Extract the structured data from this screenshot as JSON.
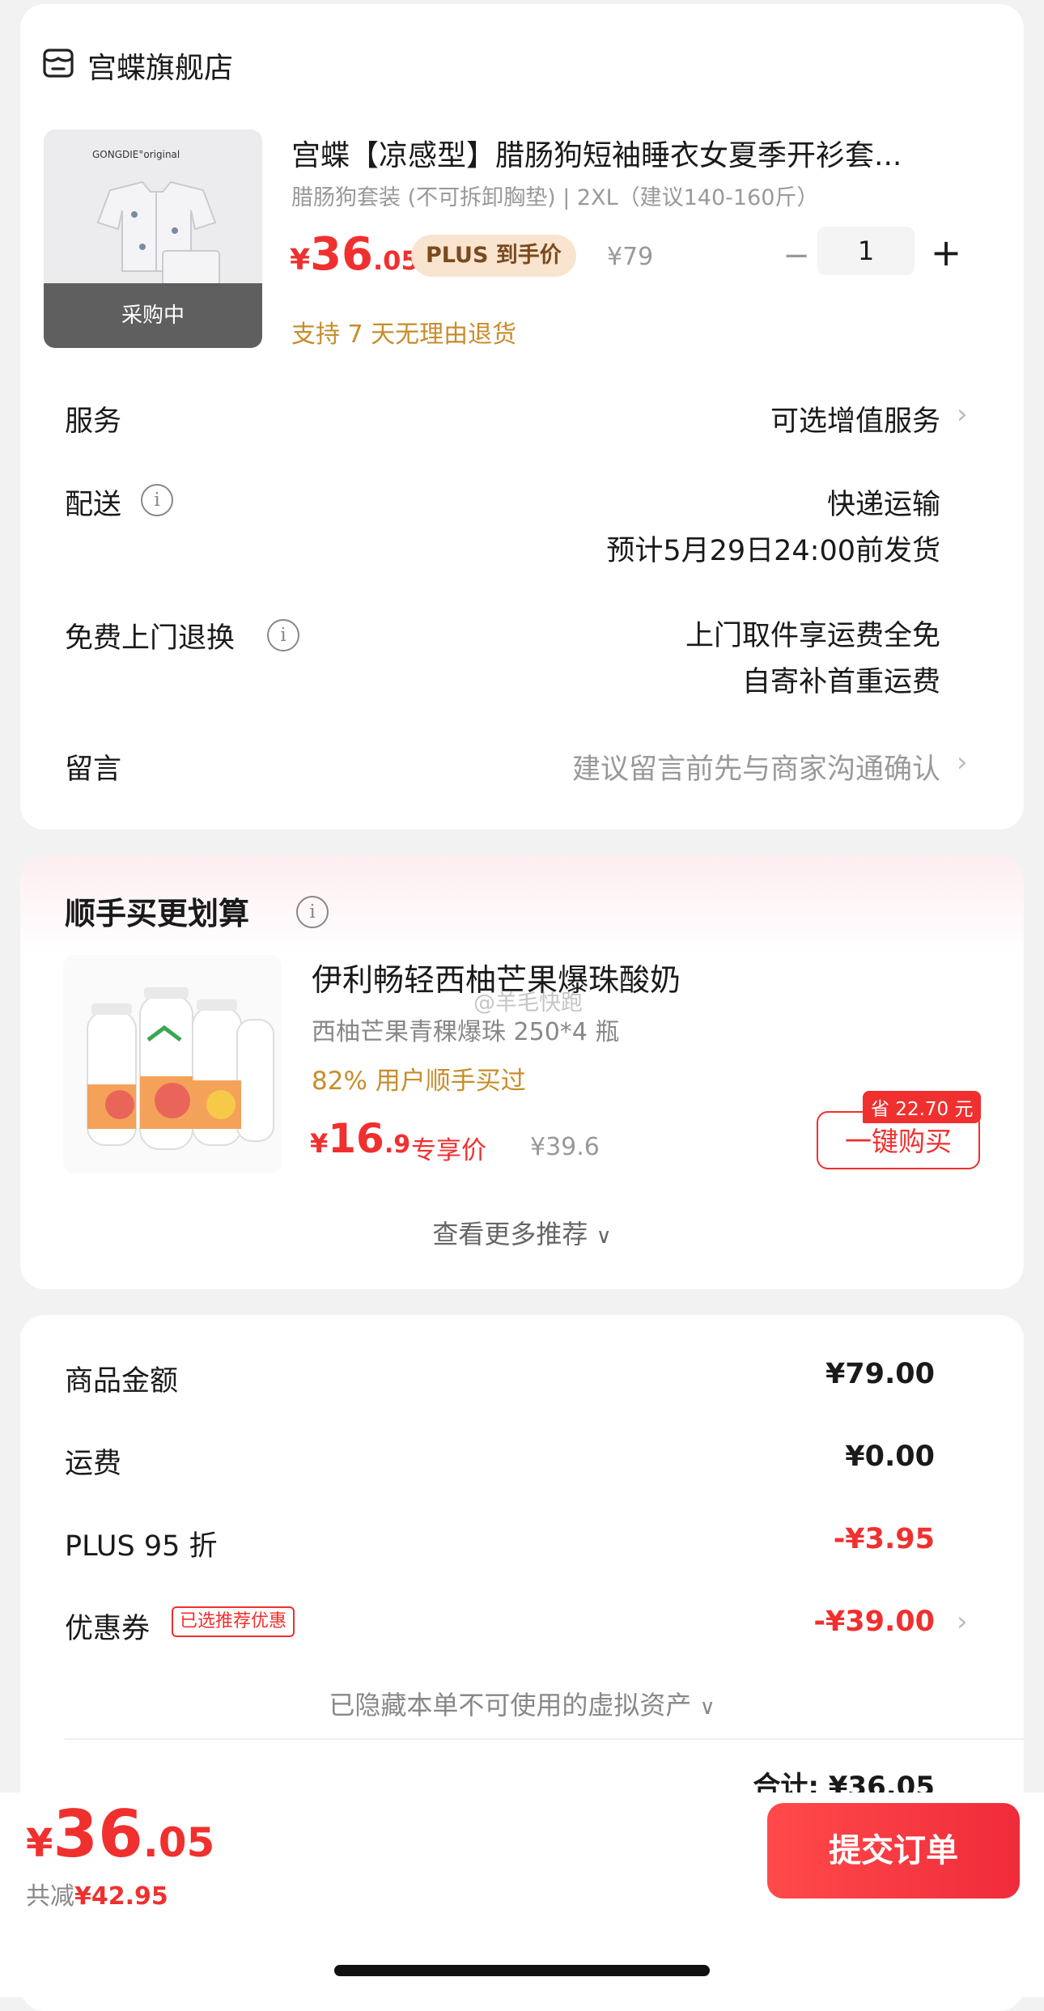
{
  "store": {
    "name": "宫蝶旗舰店",
    "icon": "store-icon"
  },
  "product": {
    "image_brand": "GONGDIE°original",
    "image_overlay": "采购中",
    "title": "宫蝶【凉感型】腊肠狗短袖睡衣女夏季开衫套...",
    "spec": "腊肠狗套装 (不可拆卸胸垫)  |  2XL（建议140-160斤）",
    "price_symbol": "¥",
    "price_int": "36",
    "price_dec": ".05",
    "plus_label": "PLUS 到手价",
    "original_price": "¥79",
    "quantity": "1",
    "return_note": "支持 7 天无理由退货"
  },
  "rows": {
    "service": {
      "label": "服务",
      "value": "可选增值服务"
    },
    "delivery": {
      "label": "配送",
      "line1": "快递运输",
      "line2": "预计5月29日24:00前发货"
    },
    "pickup": {
      "label": "免费上门退换",
      "line1": "上门取件享运费全免",
      "line2": "自寄补首重运费"
    },
    "note": {
      "label": "留言",
      "placeholder": "建议留言前先与商家沟通确认"
    }
  },
  "recommend": {
    "title": "顺手买更划算",
    "item": {
      "title": "伊利畅轻西柚芒果爆珠酸奶",
      "spec": "西柚芒果青稞爆珠 250*4 瓶",
      "bought": "82% 用户顺手买过",
      "price_symbol": "¥",
      "price_int": "16",
      "price_dec": ".9",
      "price_tag": "专享价",
      "original_price": "¥39.6",
      "save_badge": "省 22.70 元",
      "buy_label": "一键购买"
    },
    "more_label": "查看更多推荐"
  },
  "summary": {
    "goods": {
      "label": "商品金额",
      "value": "¥79.00"
    },
    "shipping": {
      "label": "运费",
      "value": "¥0.00"
    },
    "plus": {
      "label": "PLUS 95 折",
      "value": "-¥3.95"
    },
    "coupon": {
      "label": "优惠券",
      "tag": "已选推荐优惠",
      "value": "-¥39.00"
    },
    "hidden_assets": "已隐藏本单不可使用的虚拟资产",
    "total_partial": "合计: ¥36.05"
  },
  "bottom": {
    "price_symbol": "¥",
    "price_int": "36",
    "price_dec": ".05",
    "saved_label": "共减",
    "saved_value": "¥42.95",
    "submit_label": "提交订单"
  },
  "watermark": "@羊毛快跑",
  "colors": {
    "accent": "#f0302f",
    "gold": "#c78d2b",
    "plus_bg": "#f8e4cf"
  }
}
